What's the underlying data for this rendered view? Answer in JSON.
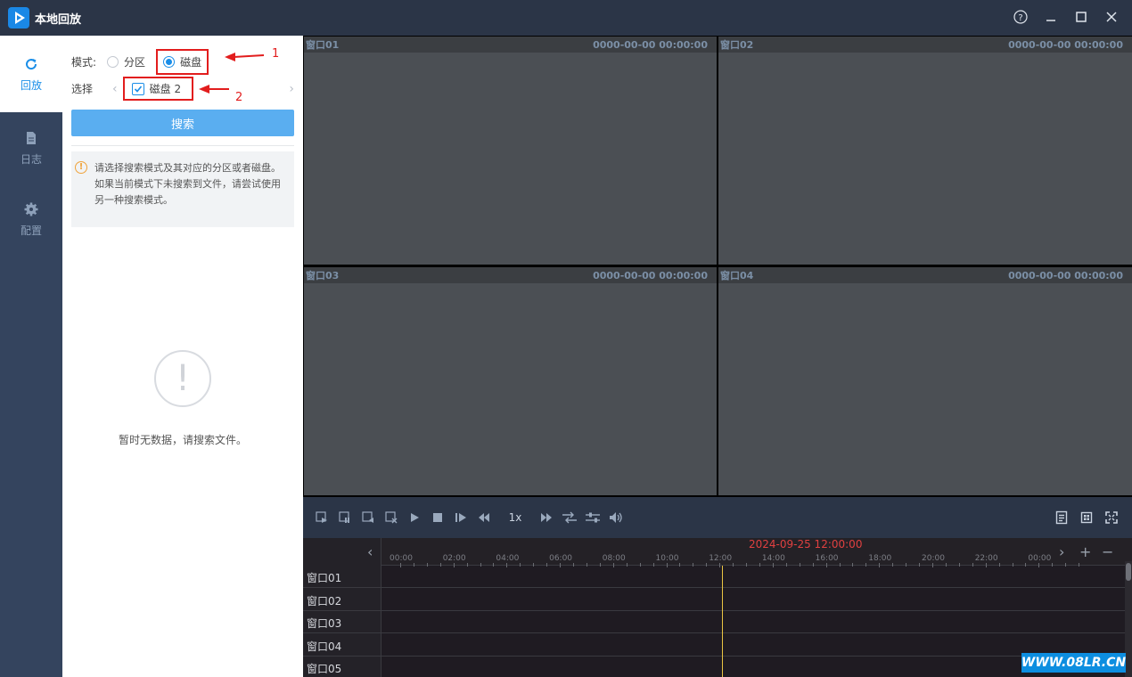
{
  "window": {
    "title": "本地回放"
  },
  "nav": [
    {
      "label": "回放",
      "icon": "refresh-icon"
    },
    {
      "label": "日志",
      "icon": "document-icon"
    },
    {
      "label": "配置",
      "icon": "gear-icon"
    }
  ],
  "panel": {
    "mode_label": "模式:",
    "mode_options": [
      "分区",
      "磁盘"
    ],
    "mode_selected": "磁盘",
    "select_label": "选择",
    "disk_item": "磁盘 2",
    "search_label": "搜索",
    "tip": "请选择搜索模式及其对应的分区或者磁盘。如果当前模式下未搜索到文件，请尝试使用另一种搜索模式。",
    "empty_text": "暂时无数据，请搜索文件。"
  },
  "annotations": {
    "one": "1",
    "two": "2"
  },
  "panes": [
    {
      "title": "窗口01",
      "time": "0000-00-00 00:00:00"
    },
    {
      "title": "窗口02",
      "time": "0000-00-00 00:00:00"
    },
    {
      "title": "窗口03",
      "time": "0000-00-00 00:00:00"
    },
    {
      "title": "窗口04",
      "time": "0000-00-00 00:00:00"
    }
  ],
  "toolbar": {
    "speed": "1x"
  },
  "timeline": {
    "current": "2024-09-25 12:00:00",
    "ticks": [
      "00:00",
      "02:00",
      "04:00",
      "06:00",
      "08:00",
      "10:00",
      "12:00",
      "14:00",
      "16:00",
      "18:00",
      "20:00",
      "22:00",
      "00:00"
    ],
    "rows": [
      "窗口01",
      "窗口02",
      "窗口03",
      "窗口04",
      "窗口05"
    ]
  },
  "watermark": "WWW.08LR.CN",
  "colors": {
    "accent": "#1a8ee8",
    "annotation": "#e21d1d",
    "cursor": "#e9c443"
  }
}
